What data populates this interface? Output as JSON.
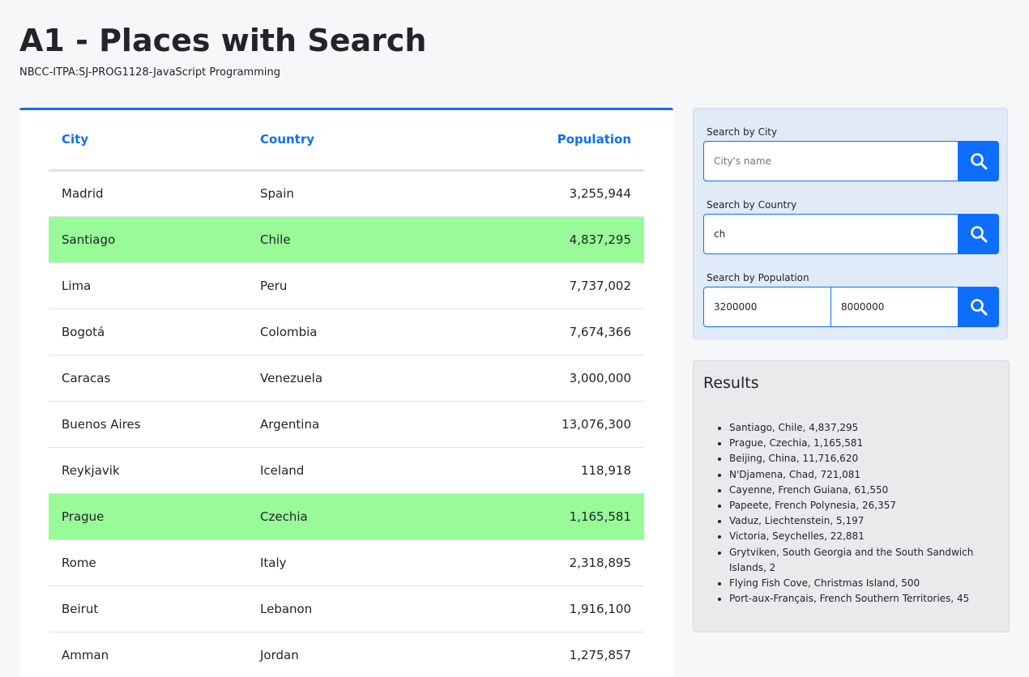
{
  "header": {
    "title": "A1 - Places with Search",
    "subtitle": "NBCC-ITPA:SJ-PROG1128-JavaScript Programming"
  },
  "table": {
    "columns": {
      "city": "City",
      "country": "Country",
      "population": "Population"
    },
    "rows": [
      {
        "city": "Madrid",
        "country": "Spain",
        "population": "3,255,944",
        "highlighted": false
      },
      {
        "city": "Santiago",
        "country": "Chile",
        "population": "4,837,295",
        "highlighted": true
      },
      {
        "city": "Lima",
        "country": "Peru",
        "population": "7,737,002",
        "highlighted": false
      },
      {
        "city": "Bogotá",
        "country": "Colombia",
        "population": "7,674,366",
        "highlighted": false
      },
      {
        "city": "Caracas",
        "country": "Venezuela",
        "population": "3,000,000",
        "highlighted": false
      },
      {
        "city": "Buenos Aires",
        "country": "Argentina",
        "population": "13,076,300",
        "highlighted": false
      },
      {
        "city": "Reykjavik",
        "country": "Iceland",
        "population": "118,918",
        "highlighted": false
      },
      {
        "city": "Prague",
        "country": "Czechia",
        "population": "1,165,581",
        "highlighted": true
      },
      {
        "city": "Rome",
        "country": "Italy",
        "population": "2,318,895",
        "highlighted": false
      },
      {
        "city": "Beirut",
        "country": "Lebanon",
        "population": "1,916,100",
        "highlighted": false
      },
      {
        "city": "Amman",
        "country": "Jordan",
        "population": "1,275,857",
        "highlighted": false
      }
    ]
  },
  "search": {
    "city": {
      "label": "Search by City",
      "placeholder": "City's name",
      "value": ""
    },
    "country": {
      "label": "Search by Country",
      "placeholder": "",
      "value": "ch"
    },
    "population": {
      "label": "Search by Population",
      "min_value": "3200000",
      "max_value": "8000000"
    },
    "button_icon": "search-icon"
  },
  "results": {
    "title": "Results",
    "items": [
      "Santiago, Chile, 4,837,295",
      "Prague, Czechia, 1,165,581",
      "Beijing, China, 11,716,620",
      "N'Djamena, Chad, 721,081",
      "Cayenne, French Guiana, 61,550",
      "Papeete, French Polynesia, 26,357",
      "Vaduz, Liechtenstein, 5,197",
      "Victoria, Seychelles, 22,881",
      "Grytviken, South Georgia and the South Sandwich Islands, 2",
      "Flying Fish Cove, Christmas Island, 500",
      "Port-aux-Français, French Southern Territories, 45"
    ]
  },
  "colors": {
    "accent": "#0d6efd",
    "highlight_row": "#98fb98",
    "search_panel_bg": "#e1ebf8",
    "results_bg": "#e9eaec",
    "page_bg": "#f6f7f8"
  }
}
